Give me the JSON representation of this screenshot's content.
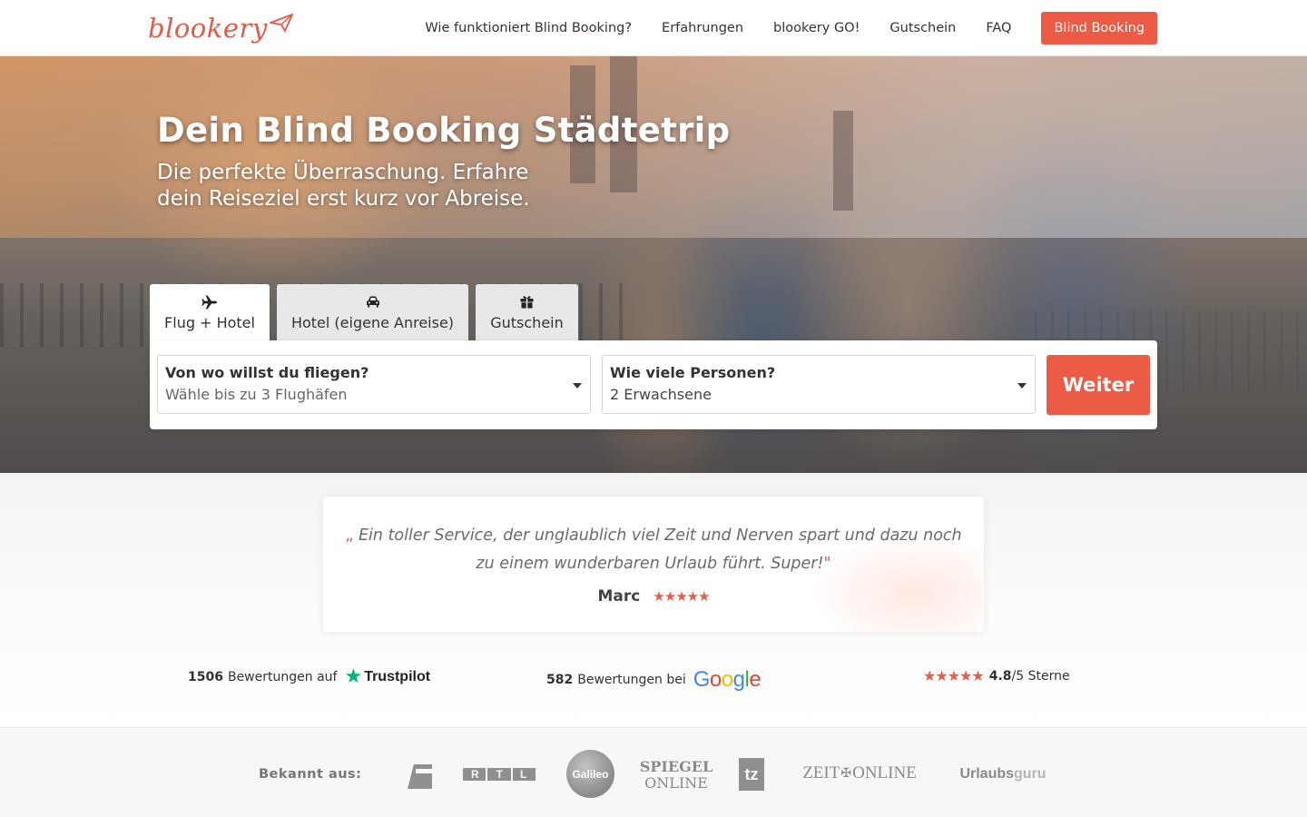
{
  "brand": {
    "name": "blookery",
    "accent": "#eb5b45"
  },
  "nav": {
    "links": [
      "Wie funktioniert Blind Booking?",
      "Erfahrungen",
      "blookery GO!",
      "Gutschein",
      "FAQ"
    ],
    "cta": "Blind Booking"
  },
  "hero": {
    "title": "Dein Blind Booking Städtetrip",
    "subtitle": "Die perfekte Überraschung. Erfahre dein Reiseziel erst kurz vor Abreise."
  },
  "tabs": [
    {
      "label": "Flug + Hotel",
      "icon": "plane-icon",
      "active": true
    },
    {
      "label": "Hotel (eigene Anreise)",
      "icon": "car-icon",
      "active": false
    },
    {
      "label": "Gutschein",
      "icon": "gift-icon",
      "active": false
    }
  ],
  "search": {
    "origin": {
      "label": "Von wo willst du fliegen?",
      "placeholder": "Wähle bis zu 3 Flughäfen"
    },
    "persons": {
      "label": "Wie viele Personen?",
      "value": "2 Erwachsene"
    },
    "submit": "Weiter"
  },
  "testimonial": {
    "open_quote": "„",
    "text": "Ein toller Service, der unglaublich viel Zeit und Nerven spart und dazu noch zu einem wunderbaren Urlaub führt. Super!",
    "close_quote": "\"",
    "author": "Marc",
    "stars": "★★★★★"
  },
  "ratings": {
    "trustpilot": {
      "count": "1506",
      "text": "Bewertungen auf",
      "logo": "Trustpilot"
    },
    "google": {
      "count": "582",
      "text": "Bewertungen bei",
      "logo": "Google"
    },
    "overall": {
      "stars": "★★★★★",
      "score": "4.8",
      "suffix": "/5 Sterne"
    }
  },
  "press": {
    "label": "Bekannt aus:",
    "logos": [
      "ProSieben",
      "RTL",
      "Galileo",
      "SPIEGEL ONLINE",
      "tz",
      "ZEIT ONLINE",
      "Urlaubsguru"
    ],
    "rtl_text": "RTL",
    "galileo_text": "Galileo",
    "spiegel_line1": "SPIEGEL",
    "spiegel_line2": "ONLINE",
    "tz_text": "tz",
    "zeit_left": "ZEIT",
    "zeit_right": "ONLINE",
    "guru_left": "Urlaubs",
    "guru_right": "guru"
  }
}
